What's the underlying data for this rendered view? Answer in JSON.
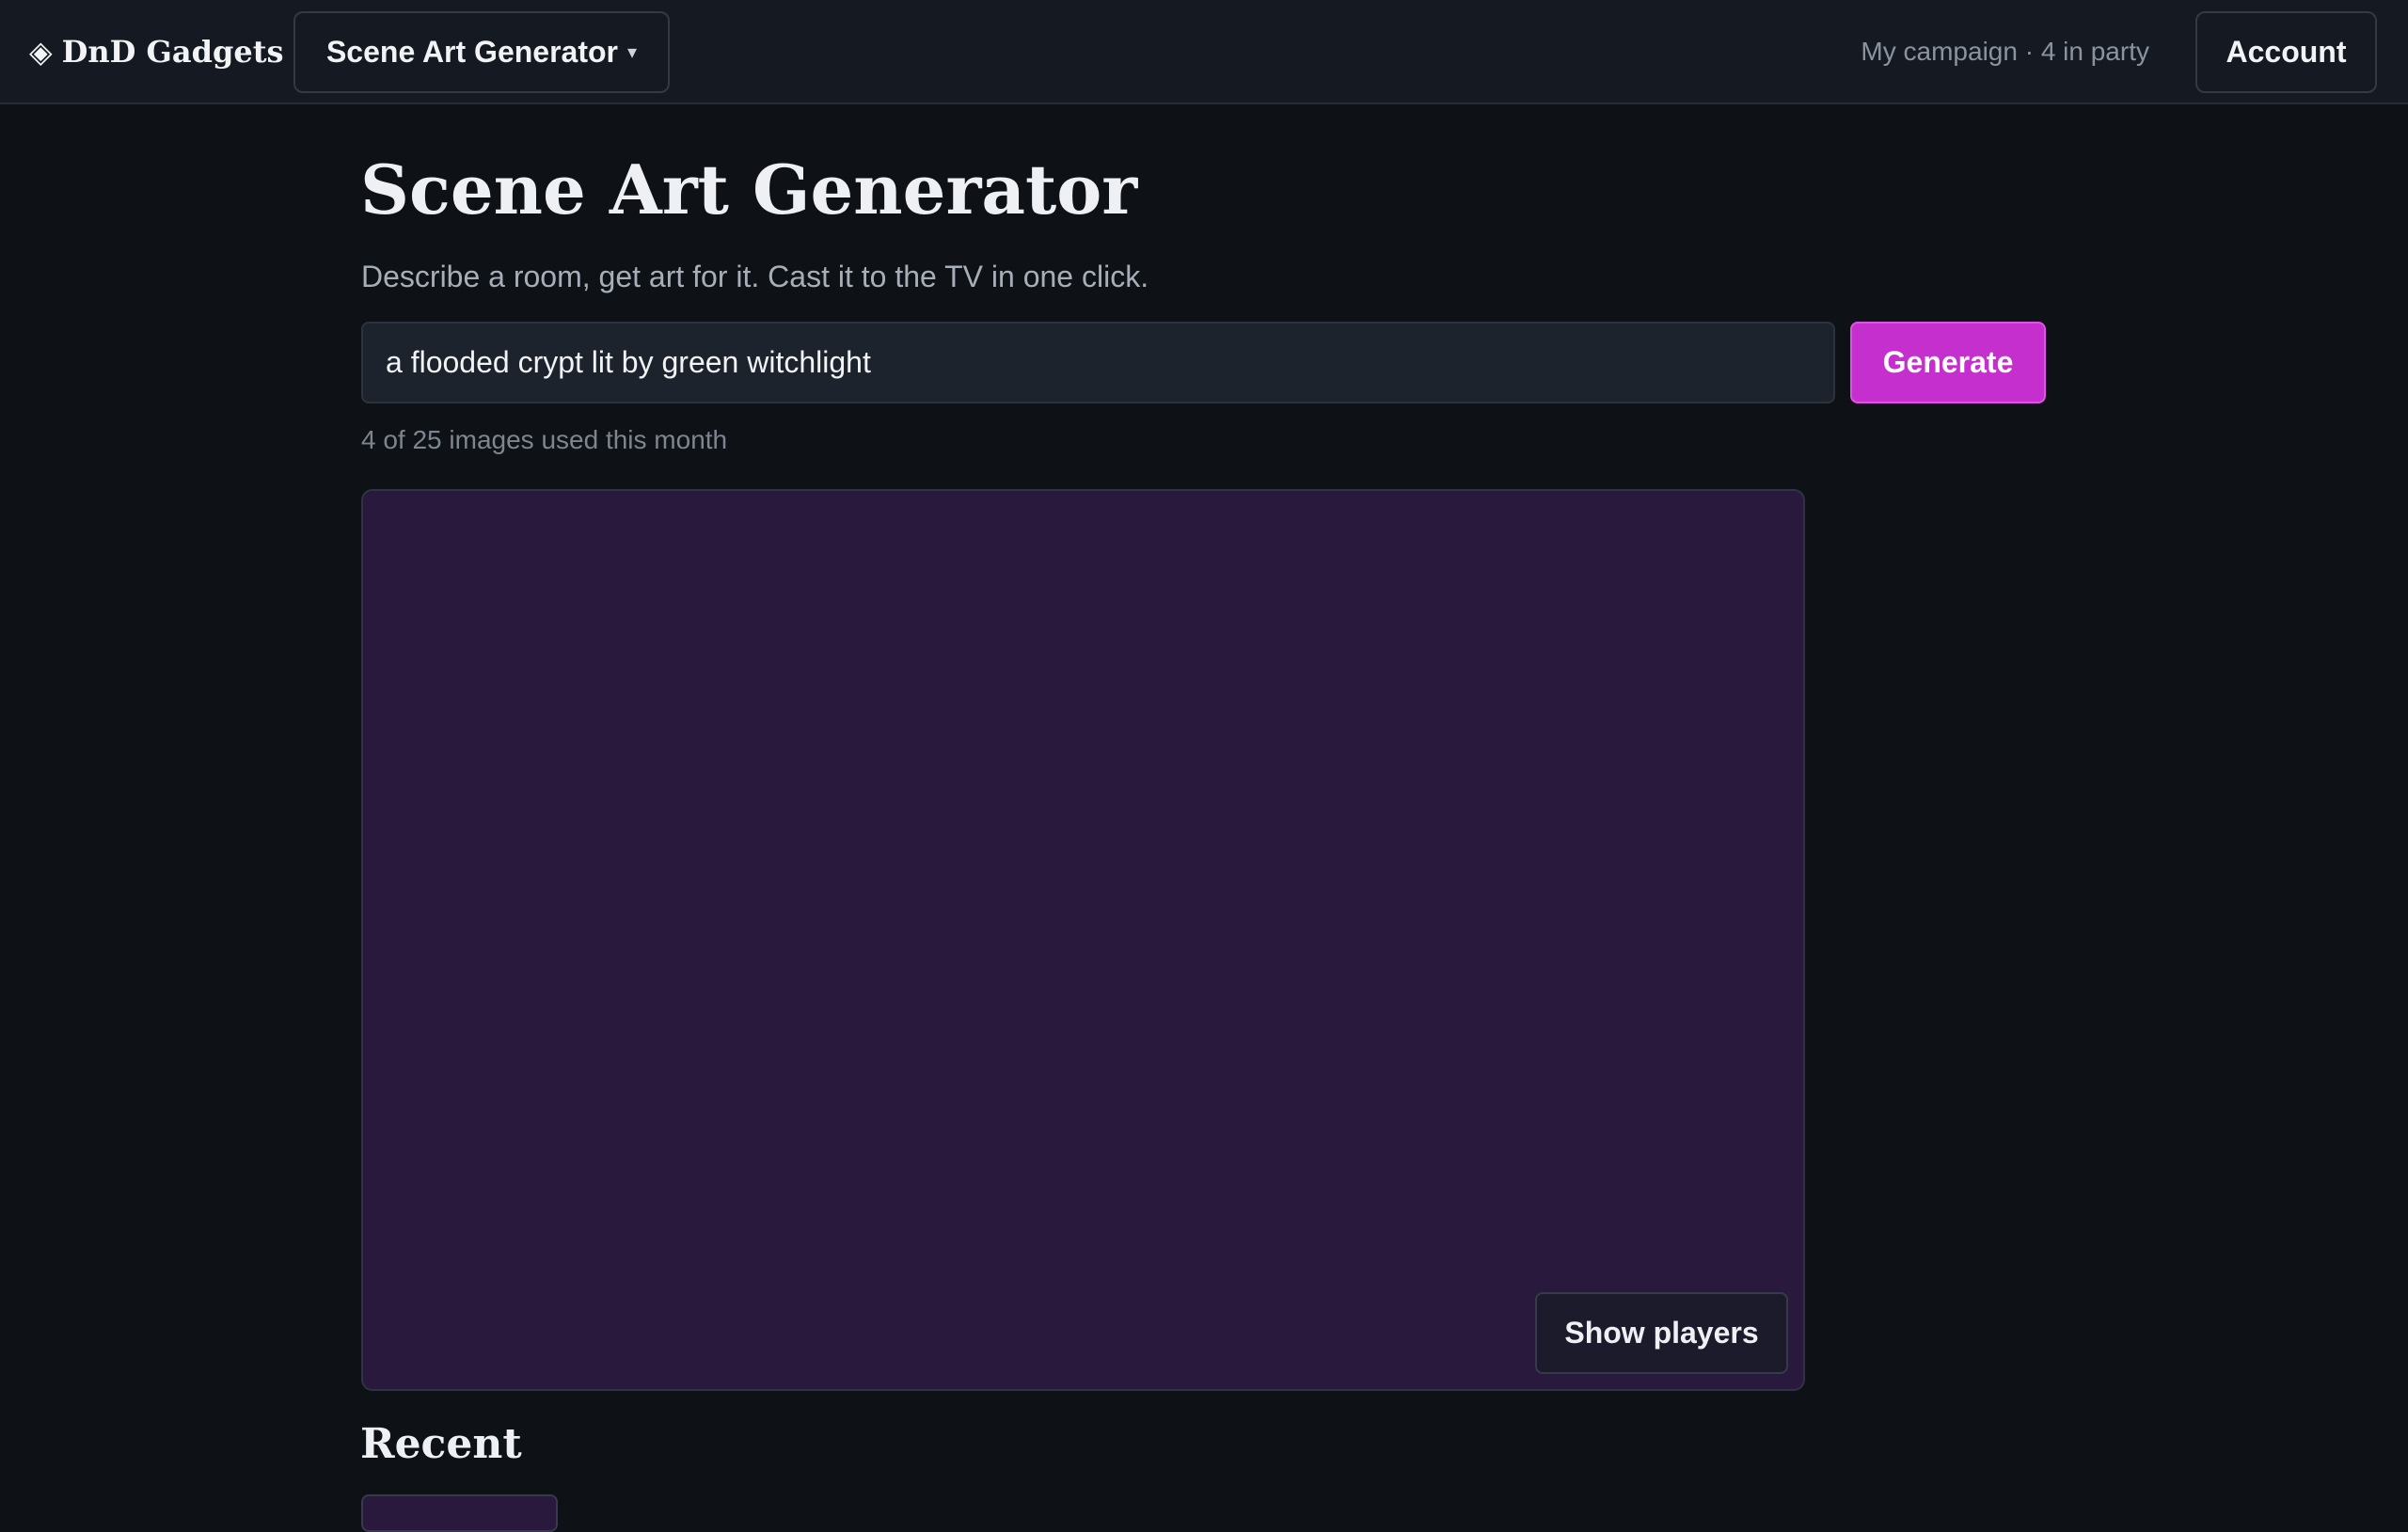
{
  "nav": {
    "brand_icon": "◈",
    "brand": "DnD Gadgets",
    "tool_select": "Scene Art Generator",
    "caret": "▾",
    "campaign": "My campaign · 4 in party",
    "account": "Account"
  },
  "main": {
    "title": "Scene Art Generator",
    "subtitle": "Describe a room, get art for it. Cast it to the TV in one click.",
    "prompt_value": "a flooded crypt lit by green witchlight",
    "generate_label": "Generate",
    "usage": "4 of 25 images used this month",
    "show_players_label": "Show players",
    "recent_heading": "Recent"
  },
  "colors": {
    "accent": "#c52fcd",
    "background": "#0e1116",
    "art_placeholder": "#28193d"
  }
}
